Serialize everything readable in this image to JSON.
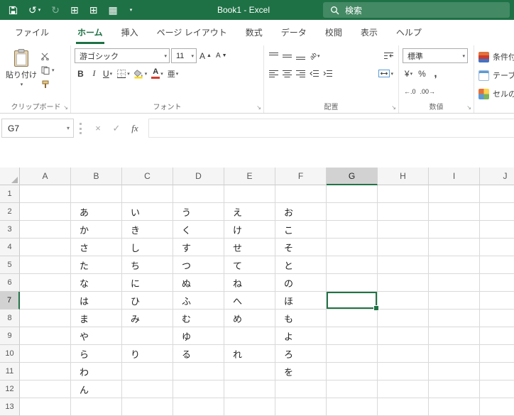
{
  "titlebar": {
    "title": "Book1 - Excel",
    "search_label": "検索"
  },
  "icons": {
    "undo": "↺",
    "redo": "↻",
    "grid_1": "⊞",
    "grid_2": "⊞",
    "sheet": "▦"
  },
  "tabs": {
    "items": [
      {
        "name": "file",
        "label": "ファイル",
        "active": false
      },
      {
        "name": "home",
        "label": "ホーム",
        "active": true
      },
      {
        "name": "insert",
        "label": "挿入",
        "active": false
      },
      {
        "name": "page-layout",
        "label": "ページ レイアウト",
        "active": false
      },
      {
        "name": "formulas",
        "label": "数式",
        "active": false
      },
      {
        "name": "data",
        "label": "データ",
        "active": false
      },
      {
        "name": "review",
        "label": "校閲",
        "active": false
      },
      {
        "name": "view",
        "label": "表示",
        "active": false
      },
      {
        "name": "help",
        "label": "ヘルプ",
        "active": false
      }
    ]
  },
  "ribbon": {
    "clipboard": {
      "label": "クリップボード",
      "paste": "貼り付け"
    },
    "font": {
      "label": "フォント",
      "name": "游ゴシック",
      "size": "11",
      "bold": "B",
      "italic": "I",
      "underline": "U",
      "ruby": "亜"
    },
    "alignment": {
      "label": "配置"
    },
    "number": {
      "label": "数値",
      "format": "標準",
      "currency": "¥",
      "percent": "%",
      "comma": ",",
      "increase_decimal": "←.0",
      "decrease_decimal": ".00→"
    },
    "styles": {
      "conditional": "条件付き",
      "format_table": "テーブル",
      "cell_styles": "セルの"
    }
  },
  "formula_bar": {
    "name_box": "G7",
    "cancel": "×",
    "enter": "✓",
    "fx": "fx"
  },
  "grid": {
    "columns": [
      "A",
      "B",
      "C",
      "D",
      "E",
      "F",
      "G",
      "H",
      "I",
      "J"
    ],
    "row_count": 13,
    "selected_column": "G",
    "selected_row": 7,
    "selected_cell": "G7",
    "cells": {
      "B2": "あ",
      "C2": "い",
      "D2": "う",
      "E2": "え",
      "F2": "お",
      "B3": "か",
      "C3": "き",
      "D3": "く",
      "E3": "け",
      "F3": "こ",
      "B4": "さ",
      "C4": "し",
      "D4": "す",
      "E4": "せ",
      "F4": "そ",
      "B5": "た",
      "C5": "ち",
      "D5": "つ",
      "E5": "て",
      "F5": "と",
      "B6": "な",
      "C6": "に",
      "D6": "ぬ",
      "E6": "ね",
      "F6": "の",
      "B7": "は",
      "C7": "ひ",
      "D7": "ふ",
      "E7": "へ",
      "F7": "ほ",
      "B8": "ま",
      "C8": "み",
      "D8": "む",
      "E8": "め",
      "F8": "も",
      "B9": "や",
      "D9": "ゆ",
      "F9": "よ",
      "B10": "ら",
      "C10": "り",
      "D10": "る",
      "E10": "れ",
      "F10": "ろ",
      "B11": "わ",
      "F11": "を",
      "B12": "ん"
    }
  },
  "colors": {
    "titlebar_green": "#1e7145",
    "accent_green": "#217346",
    "selected_header_bg": "#d2d2d2",
    "gridline": "#d9d9d9",
    "header_bg": "#f5f5f5",
    "fill_color_indicator": "#ffd800",
    "font_color_indicator": "#d83b2d"
  }
}
